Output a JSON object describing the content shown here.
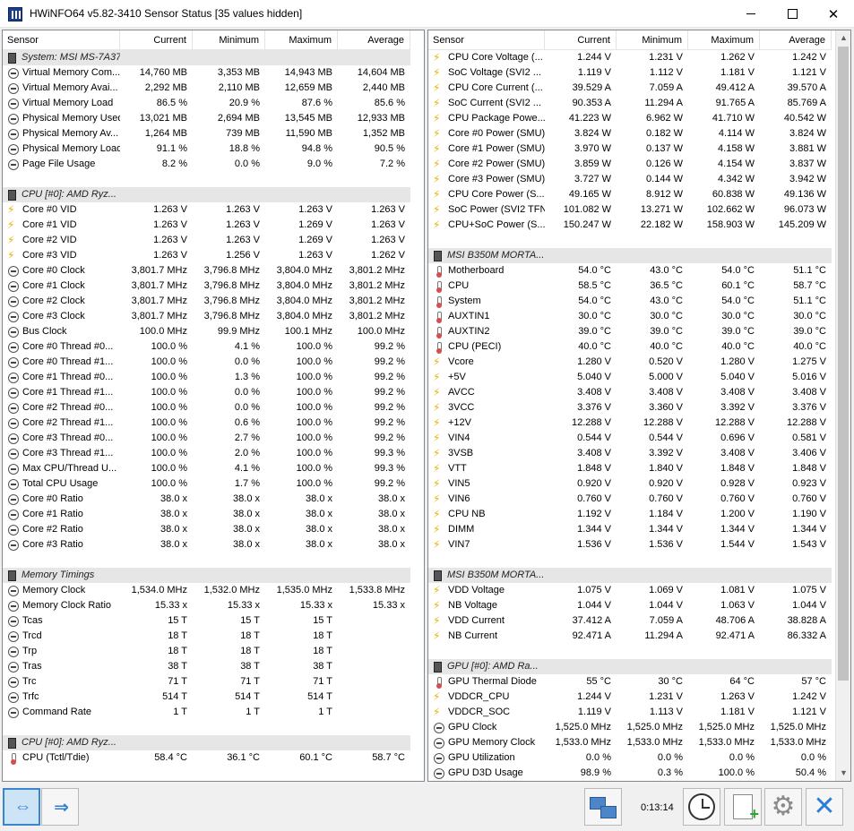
{
  "window": {
    "title": "HWiNFO64 v5.82-3410 Sensor Status [35 values hidden]"
  },
  "columns": {
    "sensor": "Sensor",
    "current": "Current",
    "minimum": "Minimum",
    "maximum": "Maximum",
    "average": "Average"
  },
  "left_rows": [
    {
      "type": "group",
      "name": "System: MSI MS-7A37"
    },
    {
      "icon": "gauge",
      "name": "Virtual Memory Com...",
      "cur": "14,760 MB",
      "min": "3,353 MB",
      "max": "14,943 MB",
      "avg": "14,604 MB"
    },
    {
      "icon": "gauge",
      "name": "Virtual Memory Avai...",
      "cur": "2,292 MB",
      "min": "2,110 MB",
      "max": "12,659 MB",
      "avg": "2,440 MB"
    },
    {
      "icon": "gauge",
      "name": "Virtual Memory Load",
      "cur": "86.5 %",
      "min": "20.9 %",
      "max": "87.6 %",
      "avg": "85.6 %"
    },
    {
      "icon": "gauge",
      "name": "Physical Memory Used",
      "cur": "13,021 MB",
      "min": "2,694 MB",
      "max": "13,545 MB",
      "avg": "12,933 MB"
    },
    {
      "icon": "gauge",
      "name": "Physical Memory Av...",
      "cur": "1,264 MB",
      "min": "739 MB",
      "max": "11,590 MB",
      "avg": "1,352 MB"
    },
    {
      "icon": "gauge",
      "name": "Physical Memory Load",
      "cur": "91.1 %",
      "min": "18.8 %",
      "max": "94.8 %",
      "avg": "90.5 %"
    },
    {
      "icon": "gauge",
      "name": "Page File Usage",
      "cur": "8.2 %",
      "min": "0.0 %",
      "max": "9.0 %",
      "avg": "7.2 %"
    },
    {
      "type": "blank"
    },
    {
      "type": "group",
      "name": "CPU [#0]: AMD Ryz..."
    },
    {
      "icon": "bolt",
      "name": "Core #0 VID",
      "cur": "1.263 V",
      "min": "1.263 V",
      "max": "1.263 V",
      "avg": "1.263 V"
    },
    {
      "icon": "bolt",
      "name": "Core #1 VID",
      "cur": "1.263 V",
      "min": "1.263 V",
      "max": "1.269 V",
      "avg": "1.263 V"
    },
    {
      "icon": "bolt",
      "name": "Core #2 VID",
      "cur": "1.263 V",
      "min": "1.263 V",
      "max": "1.269 V",
      "avg": "1.263 V"
    },
    {
      "icon": "bolt",
      "name": "Core #3 VID",
      "cur": "1.263 V",
      "min": "1.256 V",
      "max": "1.263 V",
      "avg": "1.262 V"
    },
    {
      "icon": "gauge",
      "name": "Core #0 Clock",
      "cur": "3,801.7 MHz",
      "min": "3,796.8 MHz",
      "max": "3,804.0 MHz",
      "avg": "3,801.2 MHz"
    },
    {
      "icon": "gauge",
      "name": "Core #1 Clock",
      "cur": "3,801.7 MHz",
      "min": "3,796.8 MHz",
      "max": "3,804.0 MHz",
      "avg": "3,801.2 MHz"
    },
    {
      "icon": "gauge",
      "name": "Core #2 Clock",
      "cur": "3,801.7 MHz",
      "min": "3,796.8 MHz",
      "max": "3,804.0 MHz",
      "avg": "3,801.2 MHz"
    },
    {
      "icon": "gauge",
      "name": "Core #3 Clock",
      "cur": "3,801.7 MHz",
      "min": "3,796.8 MHz",
      "max": "3,804.0 MHz",
      "avg": "3,801.2 MHz"
    },
    {
      "icon": "gauge",
      "name": "Bus Clock",
      "cur": "100.0 MHz",
      "min": "99.9 MHz",
      "max": "100.1 MHz",
      "avg": "100.0 MHz"
    },
    {
      "icon": "gauge",
      "name": "Core #0 Thread #0...",
      "cur": "100.0 %",
      "min": "4.1 %",
      "max": "100.0 %",
      "avg": "99.2 %"
    },
    {
      "icon": "gauge",
      "name": "Core #0 Thread #1...",
      "cur": "100.0 %",
      "min": "0.0 %",
      "max": "100.0 %",
      "avg": "99.2 %"
    },
    {
      "icon": "gauge",
      "name": "Core #1 Thread #0...",
      "cur": "100.0 %",
      "min": "1.3 %",
      "max": "100.0 %",
      "avg": "99.2 %"
    },
    {
      "icon": "gauge",
      "name": "Core #1 Thread #1...",
      "cur": "100.0 %",
      "min": "0.0 %",
      "max": "100.0 %",
      "avg": "99.2 %"
    },
    {
      "icon": "gauge",
      "name": "Core #2 Thread #0...",
      "cur": "100.0 %",
      "min": "0.0 %",
      "max": "100.0 %",
      "avg": "99.2 %"
    },
    {
      "icon": "gauge",
      "name": "Core #2 Thread #1...",
      "cur": "100.0 %",
      "min": "0.6 %",
      "max": "100.0 %",
      "avg": "99.2 %"
    },
    {
      "icon": "gauge",
      "name": "Core #3 Thread #0...",
      "cur": "100.0 %",
      "min": "2.7 %",
      "max": "100.0 %",
      "avg": "99.2 %"
    },
    {
      "icon": "gauge",
      "name": "Core #3 Thread #1...",
      "cur": "100.0 %",
      "min": "2.0 %",
      "max": "100.0 %",
      "avg": "99.3 %"
    },
    {
      "icon": "gauge",
      "name": "Max CPU/Thread U...",
      "cur": "100.0 %",
      "min": "4.1 %",
      "max": "100.0 %",
      "avg": "99.3 %"
    },
    {
      "icon": "gauge",
      "name": "Total CPU Usage",
      "cur": "100.0 %",
      "min": "1.7 %",
      "max": "100.0 %",
      "avg": "99.2 %"
    },
    {
      "icon": "gauge",
      "name": "Core #0 Ratio",
      "cur": "38.0 x",
      "min": "38.0 x",
      "max": "38.0 x",
      "avg": "38.0 x"
    },
    {
      "icon": "gauge",
      "name": "Core #1 Ratio",
      "cur": "38.0 x",
      "min": "38.0 x",
      "max": "38.0 x",
      "avg": "38.0 x"
    },
    {
      "icon": "gauge",
      "name": "Core #2 Ratio",
      "cur": "38.0 x",
      "min": "38.0 x",
      "max": "38.0 x",
      "avg": "38.0 x"
    },
    {
      "icon": "gauge",
      "name": "Core #3 Ratio",
      "cur": "38.0 x",
      "min": "38.0 x",
      "max": "38.0 x",
      "avg": "38.0 x"
    },
    {
      "type": "blank"
    },
    {
      "type": "group",
      "name": "Memory Timings"
    },
    {
      "icon": "gauge",
      "name": "Memory Clock",
      "cur": "1,534.0 MHz",
      "min": "1,532.0 MHz",
      "max": "1,535.0 MHz",
      "avg": "1,533.8 MHz"
    },
    {
      "icon": "gauge",
      "name": "Memory Clock Ratio",
      "cur": "15.33 x",
      "min": "15.33 x",
      "max": "15.33 x",
      "avg": "15.33 x"
    },
    {
      "icon": "gauge",
      "name": "Tcas",
      "cur": "15 T",
      "min": "15 T",
      "max": "15 T",
      "avg": ""
    },
    {
      "icon": "gauge",
      "name": "Trcd",
      "cur": "18 T",
      "min": "18 T",
      "max": "18 T",
      "avg": ""
    },
    {
      "icon": "gauge",
      "name": "Trp",
      "cur": "18 T",
      "min": "18 T",
      "max": "18 T",
      "avg": ""
    },
    {
      "icon": "gauge",
      "name": "Tras",
      "cur": "38 T",
      "min": "38 T",
      "max": "38 T",
      "avg": ""
    },
    {
      "icon": "gauge",
      "name": "Trc",
      "cur": "71 T",
      "min": "71 T",
      "max": "71 T",
      "avg": ""
    },
    {
      "icon": "gauge",
      "name": "Trfc",
      "cur": "514 T",
      "min": "514 T",
      "max": "514 T",
      "avg": ""
    },
    {
      "icon": "gauge",
      "name": "Command Rate",
      "cur": "1 T",
      "min": "1 T",
      "max": "1 T",
      "avg": ""
    },
    {
      "type": "blank"
    },
    {
      "type": "group",
      "name": "CPU [#0]: AMD Ryz..."
    },
    {
      "icon": "therm",
      "name": "CPU (Tctl/Tdie)",
      "cur": "58.4 °C",
      "min": "36.1 °C",
      "max": "60.1 °C",
      "avg": "58.7 °C"
    }
  ],
  "right_rows": [
    {
      "icon": "bolt",
      "name": "CPU Core Voltage (...",
      "cur": "1.244 V",
      "min": "1.231 V",
      "max": "1.262 V",
      "avg": "1.242 V"
    },
    {
      "icon": "bolt",
      "name": "SoC Voltage (SVI2 ...",
      "cur": "1.119 V",
      "min": "1.112 V",
      "max": "1.181 V",
      "avg": "1.121 V"
    },
    {
      "icon": "bolt",
      "name": "CPU Core Current (...",
      "cur": "39.529 A",
      "min": "7.059 A",
      "max": "49.412 A",
      "avg": "39.570 A"
    },
    {
      "icon": "bolt",
      "name": "SoC Current (SVI2 ...",
      "cur": "90.353 A",
      "min": "11.294 A",
      "max": "91.765 A",
      "avg": "85.769 A"
    },
    {
      "icon": "bolt",
      "name": "CPU Package Powe...",
      "cur": "41.223 W",
      "min": "6.962 W",
      "max": "41.710 W",
      "avg": "40.542 W"
    },
    {
      "icon": "bolt",
      "name": "Core #0 Power (SMU)",
      "cur": "3.824 W",
      "min": "0.182 W",
      "max": "4.114 W",
      "avg": "3.824 W"
    },
    {
      "icon": "bolt",
      "name": "Core #1 Power (SMU)",
      "cur": "3.970 W",
      "min": "0.137 W",
      "max": "4.158 W",
      "avg": "3.881 W"
    },
    {
      "icon": "bolt",
      "name": "Core #2 Power (SMU)",
      "cur": "3.859 W",
      "min": "0.126 W",
      "max": "4.154 W",
      "avg": "3.837 W"
    },
    {
      "icon": "bolt",
      "name": "Core #3 Power (SMU)",
      "cur": "3.727 W",
      "min": "0.144 W",
      "max": "4.342 W",
      "avg": "3.942 W"
    },
    {
      "icon": "bolt",
      "name": "CPU Core Power (S...",
      "cur": "49.165 W",
      "min": "8.912 W",
      "max": "60.838 W",
      "avg": "49.136 W"
    },
    {
      "icon": "bolt",
      "name": "SoC Power (SVI2 TFN)",
      "cur": "101.082 W",
      "min": "13.271 W",
      "max": "102.662 W",
      "avg": "96.073 W"
    },
    {
      "icon": "bolt",
      "name": "CPU+SoC Power (S...",
      "cur": "150.247 W",
      "min": "22.182 W",
      "max": "158.903 W",
      "avg": "145.209 W"
    },
    {
      "type": "blank"
    },
    {
      "type": "group",
      "name": "MSI B350M MORTA..."
    },
    {
      "icon": "therm",
      "name": "Motherboard",
      "cur": "54.0 °C",
      "min": "43.0 °C",
      "max": "54.0 °C",
      "avg": "51.1 °C"
    },
    {
      "icon": "therm",
      "name": "CPU",
      "cur": "58.5 °C",
      "min": "36.5 °C",
      "max": "60.1 °C",
      "avg": "58.7 °C"
    },
    {
      "icon": "therm",
      "name": "System",
      "cur": "54.0 °C",
      "min": "43.0 °C",
      "max": "54.0 °C",
      "avg": "51.1 °C"
    },
    {
      "icon": "therm",
      "name": "AUXTIN1",
      "cur": "30.0 °C",
      "min": "30.0 °C",
      "max": "30.0 °C",
      "avg": "30.0 °C"
    },
    {
      "icon": "therm",
      "name": "AUXTIN2",
      "cur": "39.0 °C",
      "min": "39.0 °C",
      "max": "39.0 °C",
      "avg": "39.0 °C"
    },
    {
      "icon": "therm",
      "name": "CPU (PECI)",
      "cur": "40.0 °C",
      "min": "40.0 °C",
      "max": "40.0 °C",
      "avg": "40.0 °C"
    },
    {
      "icon": "bolt",
      "name": "Vcore",
      "cur": "1.280 V",
      "min": "0.520 V",
      "max": "1.280 V",
      "avg": "1.275 V"
    },
    {
      "icon": "bolt",
      "name": "+5V",
      "cur": "5.040 V",
      "min": "5.000 V",
      "max": "5.040 V",
      "avg": "5.016 V"
    },
    {
      "icon": "bolt",
      "name": "AVCC",
      "cur": "3.408 V",
      "min": "3.408 V",
      "max": "3.408 V",
      "avg": "3.408 V"
    },
    {
      "icon": "bolt",
      "name": "3VCC",
      "cur": "3.376 V",
      "min": "3.360 V",
      "max": "3.392 V",
      "avg": "3.376 V"
    },
    {
      "icon": "bolt",
      "name": "+12V",
      "cur": "12.288 V",
      "min": "12.288 V",
      "max": "12.288 V",
      "avg": "12.288 V"
    },
    {
      "icon": "bolt",
      "name": "VIN4",
      "cur": "0.544 V",
      "min": "0.544 V",
      "max": "0.696 V",
      "avg": "0.581 V"
    },
    {
      "icon": "bolt",
      "name": "3VSB",
      "cur": "3.408 V",
      "min": "3.392 V",
      "max": "3.408 V",
      "avg": "3.406 V"
    },
    {
      "icon": "bolt",
      "name": "VTT",
      "cur": "1.848 V",
      "min": "1.840 V",
      "max": "1.848 V",
      "avg": "1.848 V"
    },
    {
      "icon": "bolt",
      "name": "VIN5",
      "cur": "0.920 V",
      "min": "0.920 V",
      "max": "0.928 V",
      "avg": "0.923 V"
    },
    {
      "icon": "bolt",
      "name": "VIN6",
      "cur": "0.760 V",
      "min": "0.760 V",
      "max": "0.760 V",
      "avg": "0.760 V"
    },
    {
      "icon": "bolt",
      "name": "CPU NB",
      "cur": "1.192 V",
      "min": "1.184 V",
      "max": "1.200 V",
      "avg": "1.190 V"
    },
    {
      "icon": "bolt",
      "name": "DIMM",
      "cur": "1.344 V",
      "min": "1.344 V",
      "max": "1.344 V",
      "avg": "1.344 V"
    },
    {
      "icon": "bolt",
      "name": "VIN7",
      "cur": "1.536 V",
      "min": "1.536 V",
      "max": "1.544 V",
      "avg": "1.543 V"
    },
    {
      "type": "blank"
    },
    {
      "type": "group",
      "name": "MSI B350M MORTA..."
    },
    {
      "icon": "bolt",
      "name": "VDD Voltage",
      "cur": "1.075 V",
      "min": "1.069 V",
      "max": "1.081 V",
      "avg": "1.075 V"
    },
    {
      "icon": "bolt",
      "name": "NB Voltage",
      "cur": "1.044 V",
      "min": "1.044 V",
      "max": "1.063 V",
      "avg": "1.044 V"
    },
    {
      "icon": "bolt",
      "name": "VDD Current",
      "cur": "37.412 A",
      "min": "7.059 A",
      "max": "48.706 A",
      "avg": "38.828 A"
    },
    {
      "icon": "bolt",
      "name": "NB Current",
      "cur": "92.471 A",
      "min": "11.294 A",
      "max": "92.471 A",
      "avg": "86.332 A"
    },
    {
      "type": "blank"
    },
    {
      "type": "group",
      "name": "GPU [#0]: AMD Ra..."
    },
    {
      "icon": "therm",
      "name": "GPU Thermal Diode",
      "cur": "55 °C",
      "min": "30 °C",
      "max": "64 °C",
      "avg": "57 °C"
    },
    {
      "icon": "bolt",
      "name": "VDDCR_CPU",
      "cur": "1.244 V",
      "min": "1.231 V",
      "max": "1.263 V",
      "avg": "1.242 V"
    },
    {
      "icon": "bolt",
      "name": "VDDCR_SOC",
      "cur": "1.119 V",
      "min": "1.113 V",
      "max": "1.181 V",
      "avg": "1.121 V"
    },
    {
      "icon": "gauge",
      "name": "GPU Clock",
      "cur": "1,525.0 MHz",
      "min": "1,525.0 MHz",
      "max": "1,525.0 MHz",
      "avg": "1,525.0 MHz"
    },
    {
      "icon": "gauge",
      "name": "GPU Memory Clock",
      "cur": "1,533.0 MHz",
      "min": "1,533.0 MHz",
      "max": "1,533.0 MHz",
      "avg": "1,533.0 MHz"
    },
    {
      "icon": "gauge",
      "name": "GPU Utilization",
      "cur": "0.0 %",
      "min": "0.0 %",
      "max": "0.0 %",
      "avg": "0.0 %"
    },
    {
      "icon": "gauge",
      "name": "GPU D3D Usage",
      "cur": "98.9 %",
      "min": "0.3 %",
      "max": "100.0 %",
      "avg": "50.4 %"
    }
  ],
  "statusbar": {
    "timer": "0:13:14"
  },
  "icons": {
    "scroll_up": "▲",
    "scroll_down": "▼",
    "nav_left": "⇔",
    "nav_right": "⇒",
    "gear": "⚙"
  }
}
